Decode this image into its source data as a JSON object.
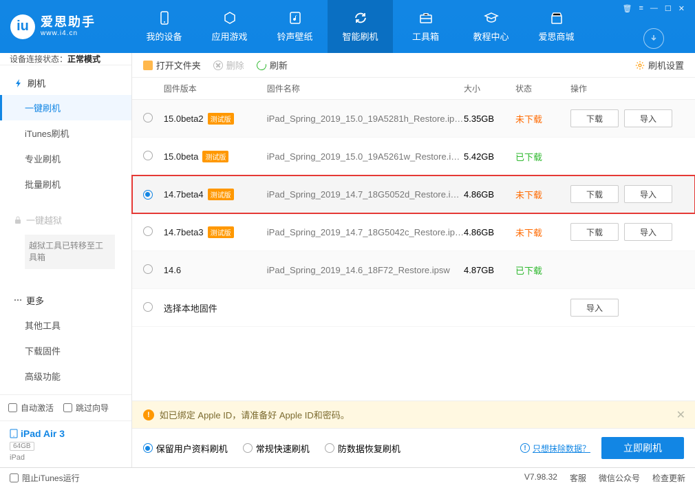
{
  "brand": {
    "title": "爱思助手",
    "url": "www.i4.cn"
  },
  "nav": [
    {
      "label": "我的设备",
      "icon": "phone"
    },
    {
      "label": "应用游戏",
      "icon": "apps"
    },
    {
      "label": "铃声壁纸",
      "icon": "music"
    },
    {
      "label": "智能刷机",
      "icon": "refresh"
    },
    {
      "label": "工具箱",
      "icon": "tools"
    },
    {
      "label": "教程中心",
      "icon": "grad"
    },
    {
      "label": "爱思商城",
      "icon": "shop"
    }
  ],
  "conn": {
    "label": "设备连接状态：",
    "value": "正常模式"
  },
  "sidebar": {
    "flash": {
      "head": "刷机",
      "items": [
        "一键刷机",
        "iTunes刷机",
        "专业刷机",
        "批量刷机"
      ]
    },
    "jailbreak": {
      "head": "一键越狱",
      "note": "越狱工具已转移至工具箱"
    },
    "more": {
      "head": "更多",
      "items": [
        "其他工具",
        "下载固件",
        "高级功能"
      ]
    },
    "checks": [
      "自动激活",
      "跳过向导"
    ],
    "device": {
      "name": "iPad Air 3",
      "storage": "64GB",
      "type": "iPad"
    }
  },
  "toolbar": {
    "open": "打开文件夹",
    "delete": "删除",
    "refresh": "刷新",
    "settings": "刷机设置"
  },
  "cols": {
    "version": "固件版本",
    "name": "固件名称",
    "size": "大小",
    "status": "状态",
    "ops": "操作"
  },
  "badges": {
    "beta": "测试版"
  },
  "buttons": {
    "download": "下载",
    "import": "导入"
  },
  "statuses": {
    "not": "未下载",
    "done": "已下载"
  },
  "rows": [
    {
      "version": "15.0beta2",
      "beta": true,
      "name": "iPad_Spring_2019_15.0_19A5281h_Restore.ip…",
      "size": "5.35GB",
      "status": "not",
      "ops": [
        "download",
        "import"
      ],
      "alt": true
    },
    {
      "version": "15.0beta",
      "beta": true,
      "name": "iPad_Spring_2019_15.0_19A5261w_Restore.i…",
      "size": "5.42GB",
      "status": "done",
      "ops": []
    },
    {
      "version": "14.7beta4",
      "beta": true,
      "name": "iPad_Spring_2019_14.7_18G5052d_Restore.i…",
      "size": "4.86GB",
      "status": "not",
      "ops": [
        "download",
        "import"
      ],
      "highlight": true,
      "selected": true
    },
    {
      "version": "14.7beta3",
      "beta": true,
      "name": "iPad_Spring_2019_14.7_18G5042c_Restore.ip…",
      "size": "4.86GB",
      "status": "not",
      "ops": [
        "download",
        "import"
      ]
    },
    {
      "version": "14.6",
      "beta": false,
      "name": "iPad_Spring_2019_14.6_18F72_Restore.ipsw",
      "size": "4.87GB",
      "status": "done",
      "ops": [],
      "alt": true
    },
    {
      "version": "选择本地固件",
      "beta": false,
      "name": "",
      "size": "",
      "status": "",
      "ops": [
        "import"
      ],
      "local": true
    }
  ],
  "notice": "如已绑定 Apple ID，请准备好 Apple ID和密码。",
  "actions": {
    "opts": [
      "保留用户资料刷机",
      "常规快速刷机",
      "防数据恢复刷机"
    ],
    "erase": "只想抹除数据？",
    "flash": "立即刷机"
  },
  "footer": {
    "block": "阻止iTunes运行",
    "version": "V7.98.32",
    "links": [
      "客服",
      "微信公众号",
      "检查更新"
    ]
  }
}
